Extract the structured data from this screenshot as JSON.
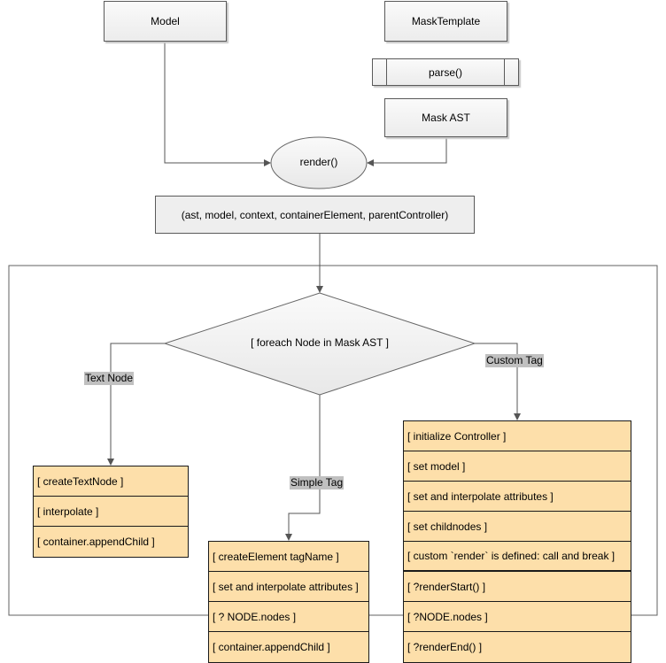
{
  "nodes": {
    "model": "Model",
    "mask_template": "MaskTemplate",
    "parse": "parse()",
    "mask_ast": "Mask AST",
    "render": "render()",
    "params": "(ast, model, context, containerElement, parentController)",
    "decision": "[ foreach Node in Mask AST ]"
  },
  "edge_labels": {
    "text_node": "Text Node",
    "simple_tag": "Simple Tag",
    "custom_tag": "Custom Tag"
  },
  "text_node_steps": [
    "[ createTextNode ]",
    "[ interpolate ]",
    "[ container.appendChild ]"
  ],
  "simple_tag_steps": [
    "[ createElement tagName ]",
    "[ set and interpolate attributes ]",
    "[ ? NODE.nodes ]",
    "[ container.appendChild ]"
  ],
  "custom_tag_steps": [
    "[ initialize Controller ]",
    "[ set model ]",
    "[ set and interpolate attributes ]",
    "[ set childnodes ]",
    "[ custom `render` is defined: call and break ]",
    "[ ?renderStart() ]",
    "[ ?NODE.nodes ]",
    "[ ?renderEnd() ]"
  ],
  "colors": {
    "step_fill": "#fddfaa",
    "label_bg": "#c0c0c0",
    "node_fill": "#f0f0f0"
  }
}
